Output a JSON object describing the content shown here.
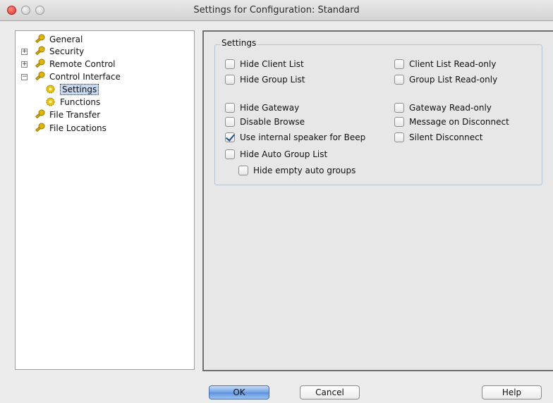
{
  "window": {
    "title": "Settings for Configuration: Standard"
  },
  "tree": {
    "items": [
      {
        "label": "General",
        "expander": "",
        "icon": "wrench-icon"
      },
      {
        "label": "Security",
        "expander": "+",
        "icon": "wrench-icon"
      },
      {
        "label": "Remote Control",
        "expander": "+",
        "icon": "wrench-icon"
      },
      {
        "label": "Control Interface",
        "expander": "−",
        "icon": "wrench-icon"
      },
      {
        "label": "Settings",
        "expander": "",
        "icon": "gear-icon",
        "selected": true
      },
      {
        "label": "Functions",
        "expander": "",
        "icon": "gear-icon"
      },
      {
        "label": "File Transfer",
        "expander": "",
        "icon": "wrench-icon"
      },
      {
        "label": "File Locations",
        "expander": "",
        "icon": "wrench-icon"
      }
    ]
  },
  "settings": {
    "group_title": "Settings",
    "left": [
      {
        "label": "Hide Client List",
        "checked": false
      },
      {
        "label": "Hide Group List",
        "checked": false
      },
      {
        "label": "Hide Gateway",
        "checked": false
      },
      {
        "label": "Disable Browse",
        "checked": false
      },
      {
        "label": "Use internal speaker for Beep",
        "checked": true
      },
      {
        "label": "Hide Auto Group List",
        "checked": false
      },
      {
        "label": "Hide empty auto groups",
        "checked": false
      }
    ],
    "right": [
      {
        "label": "Client List Read-only",
        "checked": false
      },
      {
        "label": "Group List Read-only",
        "checked": false
      },
      {
        "label": "Gateway Read-only",
        "checked": false
      },
      {
        "label": "Message on Disconnect",
        "checked": false
      },
      {
        "label": "Silent Disconnect",
        "checked": false
      }
    ]
  },
  "buttons": {
    "ok": "OK",
    "cancel": "Cancel",
    "help": "Help"
  }
}
